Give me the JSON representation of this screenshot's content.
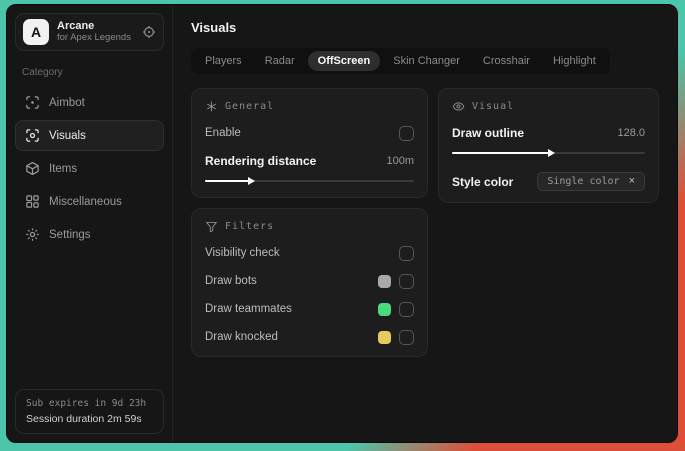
{
  "colors": {
    "desktop_teal": "#4cc5aa",
    "desktop_orange": "#dd4f38",
    "swatch_gray": "#a9a9a9",
    "swatch_green": "#4bd97d",
    "swatch_yellow": "#e7ca5e"
  },
  "sidebar": {
    "brand": {
      "logo_letter": "A",
      "name": "Arcane",
      "subtitle": "for Apex Legends"
    },
    "category_label": "Category",
    "items": [
      {
        "label": "Aimbot"
      },
      {
        "label": "Visuals"
      },
      {
        "label": "Items"
      },
      {
        "label": "Miscellaneous"
      },
      {
        "label": "Settings"
      }
    ],
    "active_item": "Visuals",
    "session": {
      "line1": "Sub expires in 9d 23h",
      "line2": "Session duration 2m 59s"
    }
  },
  "main": {
    "title": "Visuals",
    "tabs": [
      "Players",
      "Radar",
      "OffScreen",
      "Skin Changer",
      "Crosshair",
      "Highlight"
    ],
    "active_tab": "OffScreen",
    "panels": {
      "general": {
        "title": "General",
        "enable_label": "Enable",
        "enable_checked": false,
        "distance_label": "Rendering distance",
        "distance_value": "100m",
        "distance_percent": "21%"
      },
      "visual": {
        "title": "Visual",
        "outline_label": "Draw outline",
        "outline_value": "128.0",
        "outline_percent": "50%",
        "style_label": "Style color",
        "style_chip": "Single color",
        "clear_glyph": "×"
      },
      "filters": {
        "title": "Filters",
        "rows": [
          {
            "label": "Visibility check",
            "checked": false
          },
          {
            "label": "Draw bots",
            "swatch": "#a9a9a9",
            "checked": false
          },
          {
            "label": "Draw teammates",
            "swatch": "#4bd97d",
            "checked": false
          },
          {
            "label": "Draw knocked",
            "swatch": "#e7ca5e",
            "checked": false
          }
        ]
      }
    }
  }
}
